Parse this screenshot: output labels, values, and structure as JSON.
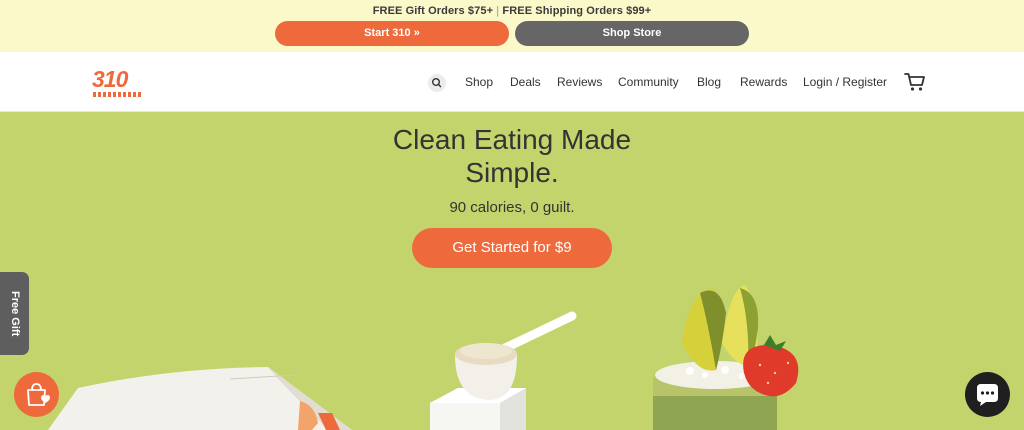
{
  "promo": {
    "gift_text": "FREE Gift Orders $75+",
    "separator": "|",
    "shipping_text": "FREE Shipping Orders $99+",
    "start_label": "Start 310 »",
    "shop_label": "Shop Store"
  },
  "header": {
    "logo_text": "310",
    "nav": [
      "Shop",
      "Deals",
      "Reviews",
      "Community",
      "Blog",
      "Rewards",
      "Login / Register"
    ]
  },
  "hero": {
    "title_line1": "Clean Eating Made",
    "title_line2": "Simple.",
    "subtitle": "90 calories, 0 guilt.",
    "cta_label": "Get Started for $9"
  },
  "side": {
    "gift_tab_label": "Free Gift"
  },
  "colors": {
    "accent": "#ee6a3c",
    "hero_bg": "#c3d46c",
    "promo_bg": "#fbf8c9"
  },
  "icons": [
    "search-icon",
    "cart-icon",
    "shopping-bag-heart-icon",
    "chat-icon"
  ]
}
